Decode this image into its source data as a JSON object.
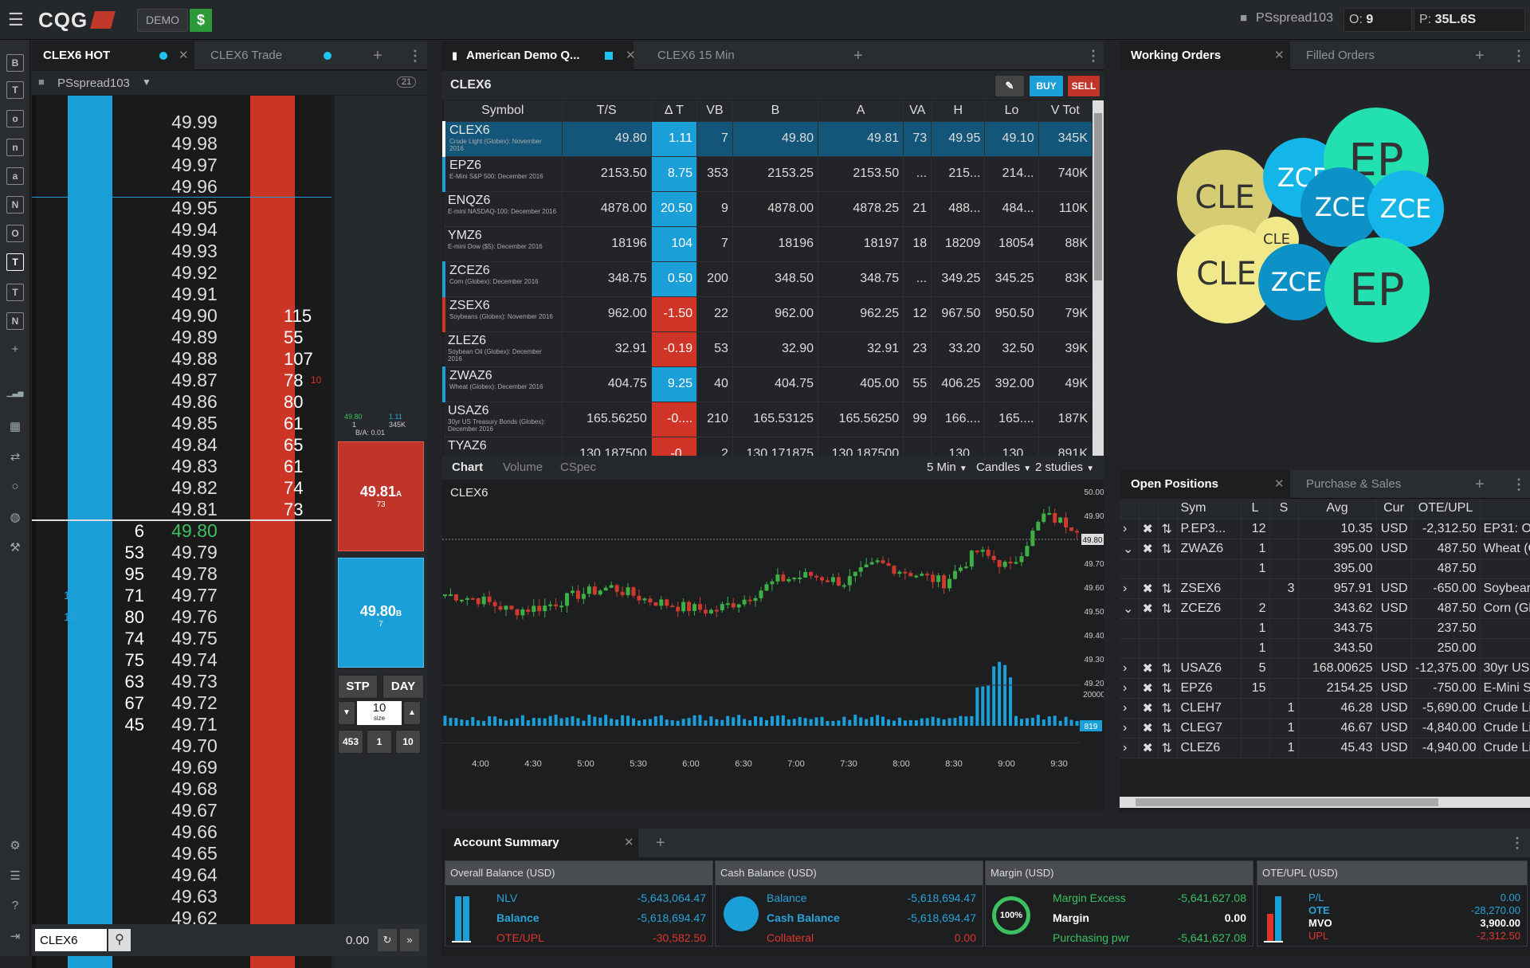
{
  "app": {
    "logo": "CQG",
    "mode": "DEMO",
    "dollar": "$",
    "user": "PSspread103",
    "orders_label": "O:",
    "orders_value": "9",
    "positions_label": "P:",
    "positions_value": "35L.6S"
  },
  "toolbar": {
    "letters": [
      "B",
      "T",
      "o",
      "n",
      "a",
      "N",
      "O",
      "T",
      "T",
      "N"
    ]
  },
  "dom": {
    "tabs": [
      {
        "label": "CLEX6 HOT"
      },
      {
        "label": "CLEX6 Trade"
      }
    ],
    "account": "PSspread103",
    "badge": "21",
    "rows": [
      {
        "price": "49.99",
        "bid": "",
        "ask": "",
        "lb": "",
        "la": ""
      },
      {
        "price": "49.98",
        "bid": "",
        "ask": "",
        "lb": "",
        "la": ""
      },
      {
        "price": "49.97",
        "bid": "",
        "ask": "",
        "lb": "",
        "la": ""
      },
      {
        "price": "49.96",
        "bid": "",
        "ask": "",
        "lb": "",
        "la": ""
      },
      {
        "price": "49.95",
        "bid": "",
        "ask": "",
        "lb": "",
        "la": ""
      },
      {
        "price": "49.94",
        "bid": "",
        "ask": "",
        "lb": "",
        "la": ""
      },
      {
        "price": "49.93",
        "bid": "",
        "ask": "",
        "lb": "",
        "la": ""
      },
      {
        "price": "49.92",
        "bid": "",
        "ask": "",
        "lb": "",
        "la": ""
      },
      {
        "price": "49.91",
        "bid": "",
        "ask": "",
        "lb": "",
        "la": ""
      },
      {
        "price": "49.90",
        "bid": "",
        "ask": "115",
        "lb": "",
        "la": ""
      },
      {
        "price": "49.89",
        "bid": "",
        "ask": "55",
        "lb": "",
        "la": ""
      },
      {
        "price": "49.88",
        "bid": "",
        "ask": "107",
        "lb": "",
        "la": ""
      },
      {
        "price": "49.87",
        "bid": "",
        "ask": "78",
        "lb": "",
        "la": "10"
      },
      {
        "price": "49.86",
        "bid": "",
        "ask": "80",
        "lb": "",
        "la": ""
      },
      {
        "price": "49.85",
        "bid": "",
        "ask": "61",
        "lb": "",
        "la": ""
      },
      {
        "price": "49.84",
        "bid": "",
        "ask": "65",
        "lb": "",
        "la": ""
      },
      {
        "price": "49.83",
        "bid": "",
        "ask": "61",
        "lb": "",
        "la": ""
      },
      {
        "price": "49.82",
        "bid": "",
        "ask": "74",
        "lb": "",
        "la": ""
      },
      {
        "price": "49.81",
        "bid": "",
        "ask": "73",
        "lb": "",
        "la": ""
      },
      {
        "price": "49.80",
        "bid": "6",
        "ask": "",
        "lb": "",
        "la": ""
      },
      {
        "price": "49.79",
        "bid": "53",
        "ask": "",
        "lb": "",
        "la": ""
      },
      {
        "price": "49.78",
        "bid": "95",
        "ask": "",
        "lb": "",
        "la": ""
      },
      {
        "price": "49.77",
        "bid": "71",
        "ask": "",
        "lb": "1",
        "la": ""
      },
      {
        "price": "49.76",
        "bid": "80",
        "ask": "",
        "lb": "10",
        "la": ""
      },
      {
        "price": "49.75",
        "bid": "74",
        "ask": "",
        "lb": "",
        "la": ""
      },
      {
        "price": "49.74",
        "bid": "75",
        "ask": "",
        "lb": "",
        "la": ""
      },
      {
        "price": "49.73",
        "bid": "63",
        "ask": "",
        "lb": "",
        "la": ""
      },
      {
        "price": "49.72",
        "bid": "67",
        "ask": "",
        "lb": "",
        "la": ""
      },
      {
        "price": "49.71",
        "bid": "45",
        "ask": "",
        "lb": "",
        "la": ""
      },
      {
        "price": "49.70",
        "bid": "",
        "ask": "",
        "lb": "",
        "la": ""
      },
      {
        "price": "49.69",
        "bid": "",
        "ask": "",
        "lb": "",
        "la": ""
      },
      {
        "price": "49.68",
        "bid": "",
        "ask": "",
        "lb": "",
        "la": ""
      },
      {
        "price": "49.67",
        "bid": "",
        "ask": "",
        "lb": "",
        "la": ""
      },
      {
        "price": "49.66",
        "bid": "",
        "ask": "",
        "lb": "",
        "la": ""
      },
      {
        "price": "49.65",
        "bid": "",
        "ask": "",
        "lb": "",
        "la": ""
      },
      {
        "price": "49.64",
        "bid": "",
        "ask": "",
        "lb": "",
        "la": ""
      },
      {
        "price": "49.63",
        "bid": "",
        "ask": "",
        "lb": "",
        "la": ""
      },
      {
        "price": "49.62",
        "bid": "",
        "ask": "",
        "lb": "",
        "la": ""
      }
    ],
    "mini": {
      "bid": "49.80",
      "bid_sz": "1",
      "delta": "1.11",
      "vol": "345K",
      "ba": "B/A: 0.01"
    },
    "ask_btn": {
      "price": "49.81",
      "sup": "A",
      "size": "73"
    },
    "bid_btn": {
      "price": "49.80",
      "sup": "B",
      "size": "7"
    },
    "stp": "STP",
    "day": "DAY",
    "size_value": "10",
    "size_label": "size",
    "q1": "453",
    "q2": "1",
    "q3": "10",
    "search": "CLEX6",
    "pl": "0.00"
  },
  "quotes": {
    "tabs": [
      {
        "label": "American Demo Q..."
      },
      {
        "label": "CLEX6 15 Min"
      }
    ],
    "title": "CLEX6",
    "buy": "BUY",
    "sell": "SELL",
    "headers": [
      "Symbol",
      "T/S",
      "Δ T",
      "VB",
      "B",
      "A",
      "VA",
      "H",
      "Lo",
      "V Tot"
    ],
    "rows": [
      {
        "sym": "CLEX6",
        "desc": "Crude Light (Globex): November 2016",
        "ts": "49.80",
        "dt": "1.11",
        "dir": "up",
        "vb": "7",
        "b": "49.80",
        "a": "49.81",
        "va": "73",
        "h": "49.95",
        "lo": "49.10",
        "vt": "345K",
        "mark": "#ffffff"
      },
      {
        "sym": "EPZ6",
        "desc": "E-Mini S&P 500: December 2016",
        "ts": "2153.50",
        "dt": "8.75",
        "dir": "up",
        "vb": "353",
        "b": "2153.25",
        "a": "2153.50",
        "va": "...",
        "h": "215...",
        "lo": "214...",
        "vt": "740K",
        "mark": "#1a9fd8"
      },
      {
        "sym": "ENQZ6",
        "desc": "E-mini NASDAQ-100: December 2016",
        "ts": "4878.00",
        "dt": "20.50",
        "dir": "up",
        "vb": "9",
        "b": "4878.00",
        "a": "4878.25",
        "va": "21",
        "h": "488...",
        "lo": "484...",
        "vt": "110K",
        "mark": ""
      },
      {
        "sym": "YMZ6",
        "desc": "E-mini Dow ($5): December 2016",
        "ts": "18196",
        "dt": "104",
        "dir": "up",
        "vb": "7",
        "b": "18196",
        "a": "18197",
        "va": "18",
        "h": "18209",
        "lo": "18054",
        "vt": "88K",
        "mark": ""
      },
      {
        "sym": "ZCEZ6",
        "desc": "Corn (Globex): December 2016",
        "ts": "348.75",
        "dt": "0.50",
        "dir": "up",
        "vb": "200",
        "b": "348.50",
        "a": "348.75",
        "va": "...",
        "h": "349.25",
        "lo": "345.25",
        "vt": "83K",
        "mark": "#1a9fd8"
      },
      {
        "sym": "ZSEX6",
        "desc": "Soybeans (Globex): November 2016",
        "ts": "962.00",
        "dt": "-1.50",
        "dir": "dn",
        "vb": "22",
        "b": "962.00",
        "a": "962.25",
        "va": "12",
        "h": "967.50",
        "lo": "950.50",
        "vt": "79K",
        "mark": "#cf3427"
      },
      {
        "sym": "ZLEZ6",
        "desc": "Soybean Oil (Globex): December 2016",
        "ts": "32.91",
        "dt": "-0.19",
        "dir": "dn",
        "vb": "53",
        "b": "32.90",
        "a": "32.91",
        "va": "23",
        "h": "33.20",
        "lo": "32.50",
        "vt": "39K",
        "mark": ""
      },
      {
        "sym": "ZWAZ6",
        "desc": "Wheat (Globex): December 2016",
        "ts": "404.75",
        "dt": "9.25",
        "dir": "up",
        "vb": "40",
        "b": "404.75",
        "a": "405.00",
        "va": "55",
        "h": "406.25",
        "lo": "392.00",
        "vt": "49K",
        "mark": "#1a9fd8"
      },
      {
        "sym": "USAZ6",
        "desc": "30yr US Treasury Bonds (Globex): December 2016",
        "ts": "165.56250",
        "dt": "-0....",
        "dir": "dn",
        "vb": "210",
        "b": "165.53125",
        "a": "165.56250",
        "va": "99",
        "h": "166....",
        "lo": "165....",
        "vt": "187K",
        "mark": ""
      },
      {
        "sym": "TYAZ6",
        "desc": "",
        "ts": "130.187500",
        "dt": "-0...",
        "dir": "dn",
        "vb": "2",
        "b": "130.171875",
        "a": "130.187500",
        "va": "",
        "h": "130...",
        "lo": "130...",
        "vt": "891K",
        "mark": ""
      }
    ]
  },
  "chart": {
    "tabs": [
      "Chart",
      "Volume",
      "CSpec"
    ],
    "interval": "5 Min",
    "style": "Candles",
    "studies": "2 studies",
    "title": "CLEX6",
    "y_ticks": [
      "50.00",
      "49.90",
      "49.80",
      "49.70",
      "49.60",
      "49.50",
      "49.40",
      "49.30",
      "49.20"
    ],
    "x_ticks": [
      "4:00",
      "4:30",
      "5:00",
      "5:30",
      "6:00",
      "6:30",
      "7:00",
      "7:30",
      "8:00",
      "8:30",
      "9:00",
      "9:30"
    ],
    "last": "49.80",
    "vol_tick": "20000",
    "vol_last": "819"
  },
  "orders": {
    "tabs": [
      {
        "label": "Working Orders"
      },
      {
        "label": "Filled Orders"
      }
    ],
    "bubbles": [
      {
        "label": "CLE",
        "color": "#d6cc73"
      },
      {
        "label": "ZCE",
        "color": "#14b6ea"
      },
      {
        "label": "EP",
        "color": "#23e0b0"
      },
      {
        "label": "CLE",
        "color": "#f1e88a"
      },
      {
        "label": "ZCE",
        "color": "#0c92c6"
      },
      {
        "label": "ZCE",
        "color": "#14b6ea"
      },
      {
        "label": "CLE",
        "color": "#f1e88a"
      },
      {
        "label": "ZCE",
        "color": "#0c92c6"
      },
      {
        "label": "EP",
        "color": "#23e0b0"
      }
    ]
  },
  "positions": {
    "tabs": [
      {
        "label": "Open Positions"
      },
      {
        "label": "Purchase & Sales"
      }
    ],
    "headers": [
      "Sym",
      "L",
      "S",
      "Avg",
      "Cur",
      "OTE/UPL"
    ],
    "rows": [
      {
        "exp": "›",
        "sym": "P.EP3...",
        "l": "12",
        "s": "",
        "avg": "10.35",
        "cur": "USD",
        "ote": "-2,312.50",
        "desc": "EP31: O",
        "tools": true
      },
      {
        "exp": "⌄",
        "sym": "ZWAZ6",
        "l": "1",
        "s": "",
        "avg": "395.00",
        "cur": "USD",
        "ote": "487.50",
        "desc": "Wheat (G",
        "tools": true
      },
      {
        "exp": "",
        "sym": "",
        "l": "1",
        "s": "",
        "avg": "395.00",
        "cur": "",
        "ote": "487.50",
        "desc": "",
        "tools": false
      },
      {
        "exp": "›",
        "sym": "ZSEX6",
        "l": "",
        "s": "3",
        "avg": "957.91",
        "cur": "USD",
        "ote": "-650.00",
        "desc": "Soybear",
        "tools": true
      },
      {
        "exp": "⌄",
        "sym": "ZCEZ6",
        "l": "2",
        "s": "",
        "avg": "343.62",
        "cur": "USD",
        "ote": "487.50",
        "desc": "Corn (Gl",
        "tools": true
      },
      {
        "exp": "",
        "sym": "",
        "l": "1",
        "s": "",
        "avg": "343.75",
        "cur": "",
        "ote": "237.50",
        "desc": "",
        "tools": false
      },
      {
        "exp": "",
        "sym": "",
        "l": "1",
        "s": "",
        "avg": "343.50",
        "cur": "",
        "ote": "250.00",
        "desc": "",
        "tools": false
      },
      {
        "exp": "›",
        "sym": "USAZ6",
        "l": "5",
        "s": "",
        "avg": "168.00625",
        "cur": "USD",
        "ote": "-12,375.00",
        "desc": "30yr US",
        "tools": true
      },
      {
        "exp": "›",
        "sym": "EPZ6",
        "l": "15",
        "s": "",
        "avg": "2154.25",
        "cur": "USD",
        "ote": "-750.00",
        "desc": "E-Mini S",
        "tools": true
      },
      {
        "exp": "›",
        "sym": "CLEH7",
        "l": "",
        "s": "1",
        "avg": "46.28",
        "cur": "USD",
        "ote": "-5,690.00",
        "desc": "Crude Li",
        "tools": true
      },
      {
        "exp": "›",
        "sym": "CLEG7",
        "l": "",
        "s": "1",
        "avg": "46.67",
        "cur": "USD",
        "ote": "-4,840.00",
        "desc": "Crude Li",
        "tools": true
      },
      {
        "exp": "›",
        "sym": "CLEZ6",
        "l": "",
        "s": "1",
        "avg": "45.43",
        "cur": "USD",
        "ote": "-4,940.00",
        "desc": "Crude Li",
        "tools": true
      }
    ]
  },
  "account": {
    "tab": "Account Summary",
    "cards": [
      {
        "title": "Overall Balance (USD)",
        "lines": [
          {
            "k": "NLV",
            "v": "-5,643,064.47",
            "c": "#2aa3d8"
          },
          {
            "k": "Balance",
            "v": "-5,618,694.47",
            "c": "#2aa3d8"
          },
          {
            "k": "OTE/UPL",
            "v": "-30,582.50",
            "c": "#e0342a"
          }
        ]
      },
      {
        "title": "Cash Balance (USD)",
        "lines": [
          {
            "k": "Balance",
            "v": "-5,618,694.47",
            "c": "#2aa3d8"
          },
          {
            "k": "Cash Balance",
            "v": "-5,618,694.47",
            "c": "#2aa3d8"
          },
          {
            "k": "Collateral",
            "v": "0.00",
            "c": "#e0342a"
          }
        ]
      },
      {
        "title": "Margin (USD)",
        "gauge": "100%",
        "lines": [
          {
            "k": "Margin Excess",
            "v": "-5,641,627.08",
            "c": "#3cc060"
          },
          {
            "k": "Margin",
            "v": "0.00",
            "c": "#ffffff"
          },
          {
            "k": "Purchasing pwr",
            "v": "-5,641,627.08",
            "c": "#3cc060"
          }
        ]
      },
      {
        "title": "OTE/UPL (USD)",
        "lines": [
          {
            "k": "P/L",
            "v": "0.00",
            "c": "#2aa3d8"
          },
          {
            "k": "OTE",
            "v": "-28,270.00",
            "c": "#2aa3d8"
          },
          {
            "k": "MVO",
            "v": "3,900.00",
            "c": "#ffffff"
          },
          {
            "k": "UPL",
            "v": "-2,312.50",
            "c": "#e0342a"
          }
        ]
      }
    ]
  }
}
